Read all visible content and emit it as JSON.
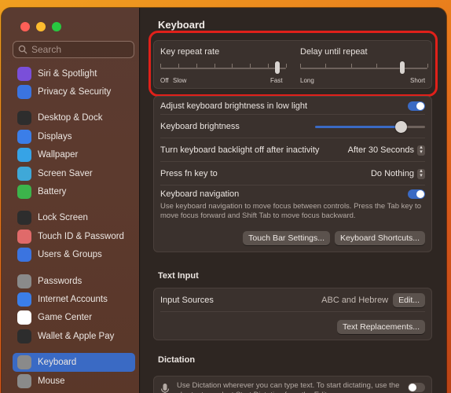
{
  "sidebar": {
    "search_placeholder": "Search",
    "groups": [
      [
        {
          "label": "Siri & Spotlight",
          "icon": "siri-icon",
          "color": "#7a4fd9"
        },
        {
          "label": "Privacy & Security",
          "icon": "hand-icon",
          "color": "#3b74e0"
        }
      ],
      [
        {
          "label": "Desktop & Dock",
          "icon": "dock-icon",
          "color": "#2d2d2d"
        },
        {
          "label": "Displays",
          "icon": "display-icon",
          "color": "#3b7ee8"
        },
        {
          "label": "Wallpaper",
          "icon": "wallpaper-icon",
          "color": "#36a3e6"
        },
        {
          "label": "Screen Saver",
          "icon": "screensaver-icon",
          "color": "#3fa8d8"
        },
        {
          "label": "Battery",
          "icon": "battery-icon",
          "color": "#3cb44b"
        }
      ],
      [
        {
          "label": "Lock Screen",
          "icon": "lock-icon",
          "color": "#2d2d2d"
        },
        {
          "label": "Touch ID & Password",
          "icon": "fingerprint-icon",
          "color": "#e06a6a"
        },
        {
          "label": "Users & Groups",
          "icon": "users-icon",
          "color": "#3b74e0"
        }
      ],
      [
        {
          "label": "Passwords",
          "icon": "key-icon",
          "color": "#8a8a8a"
        },
        {
          "label": "Internet Accounts",
          "icon": "at-icon",
          "color": "#3b7ee8"
        },
        {
          "label": "Game Center",
          "icon": "gamecenter-icon",
          "color": "#ffffff"
        },
        {
          "label": "Wallet & Apple Pay",
          "icon": "wallet-icon",
          "color": "#2d2d2d"
        }
      ],
      [
        {
          "label": "Keyboard",
          "icon": "keyboard-icon",
          "color": "#8a8a8a",
          "selected": true
        },
        {
          "label": "Mouse",
          "icon": "mouse-icon",
          "color": "#8a8a8a"
        }
      ]
    ]
  },
  "main": {
    "title": "Keyboard",
    "key_repeat": {
      "title": "Key repeat rate",
      "labels": [
        "Off",
        "Slow",
        "Fast"
      ],
      "ticks": 8,
      "value": 0.93
    },
    "delay_repeat": {
      "title": "Delay until repeat",
      "labels": [
        "Long",
        "Short"
      ],
      "ticks": 6,
      "value": 0.8
    },
    "rows": {
      "adjust_brightness": {
        "label": "Adjust keyboard brightness in low light",
        "on": true
      },
      "brightness": {
        "label": "Keyboard brightness",
        "value": 0.78
      },
      "backlight": {
        "label": "Turn keyboard backlight off after inactivity",
        "value": "After 30 Seconds"
      },
      "fn_key": {
        "label": "Press fn key to",
        "value": "Do Nothing"
      },
      "keyboard_nav": {
        "label": "Keyboard navigation",
        "on": true,
        "description": "Use keyboard navigation to move focus between controls. Press the Tab key to move focus forward and Shift Tab to move focus backward."
      }
    },
    "buttons": {
      "touch_bar": "Touch Bar Settings...",
      "shortcuts": "Keyboard Shortcuts..."
    },
    "text_input": {
      "section_title": "Text Input",
      "sources_label": "Input Sources",
      "sources_value": "ABC and Hebrew",
      "edit_button": "Edit...",
      "replacements_button": "Text Replacements..."
    },
    "dictation": {
      "section_title": "Dictation",
      "description": "Use Dictation wherever you can type text. To start dictating, use the shortcut or select Start Dictation from the Edit menu.",
      "on": false
    }
  },
  "colors": {
    "accent": "#3a6ac4",
    "highlight": "#e0201a"
  }
}
